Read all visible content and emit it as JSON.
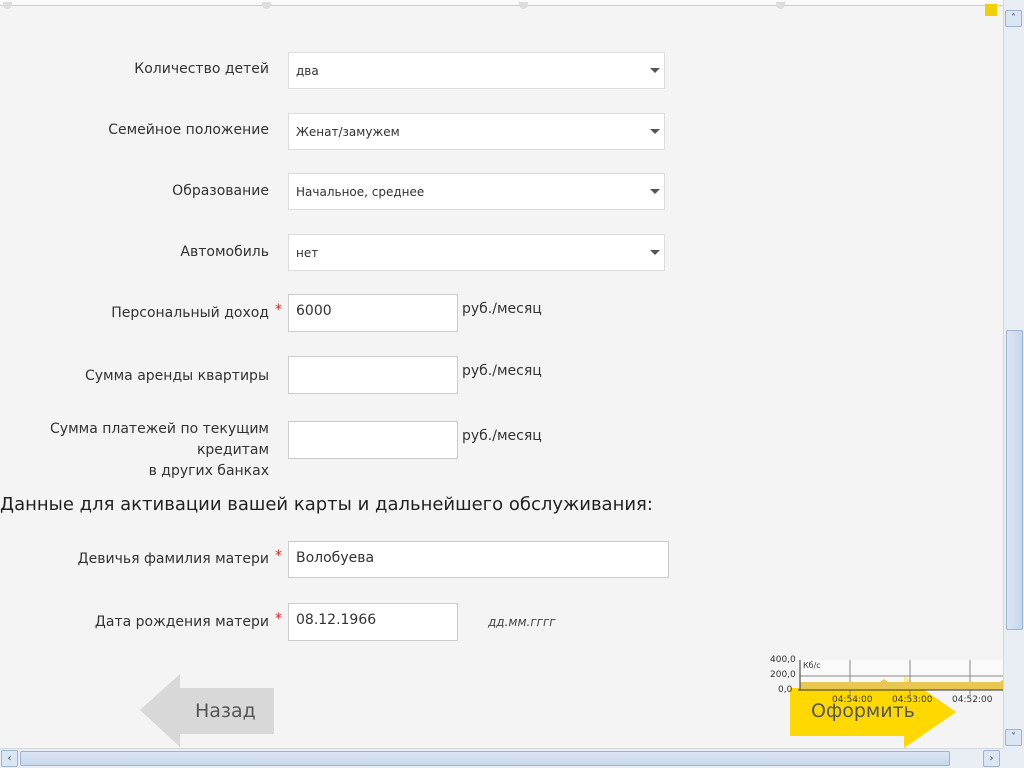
{
  "form": {
    "children": {
      "label": "Количество детей",
      "value": "два"
    },
    "marital": {
      "label": "Семейное положение",
      "value": "Женат/замужем"
    },
    "education": {
      "label": "Образование",
      "value": "Начальное, среднее"
    },
    "car": {
      "label": "Автомобиль",
      "value": "нет"
    },
    "income": {
      "label": "Персональный доход",
      "value": "6000",
      "unit": "руб./месяц",
      "required": "*"
    },
    "rent": {
      "label": "Сумма аренды квартиры",
      "value": "",
      "unit": "руб./месяц"
    },
    "credits": {
      "label1": "Сумма платежей по текущим кредитам",
      "label2": "в других банках",
      "value": "",
      "unit": "руб./месяц"
    }
  },
  "section_title": "Данные для активации вашей карты и дальнейшего обслуживания:",
  "mother": {
    "surname": {
      "label": "Девичья фамилия матери",
      "value": "Волобуева",
      "required": "*"
    },
    "birthdate": {
      "label": "Дата рождения матери",
      "value": "08.12.1966",
      "hint": "дд.мм.гггг",
      "required": "*"
    }
  },
  "buttons": {
    "back": "Назад",
    "submit": "Оформить"
  },
  "net_graph": {
    "unit": "Кб/с",
    "y_ticks": [
      "400,0",
      "200,0",
      "0,0"
    ],
    "x_ticks": [
      "04:54:00",
      "04:53:00",
      "04:52:00"
    ]
  },
  "colors": {
    "submit": "#ffd800",
    "back": "#d8d8d8",
    "graph_fill": "#e8c850"
  }
}
